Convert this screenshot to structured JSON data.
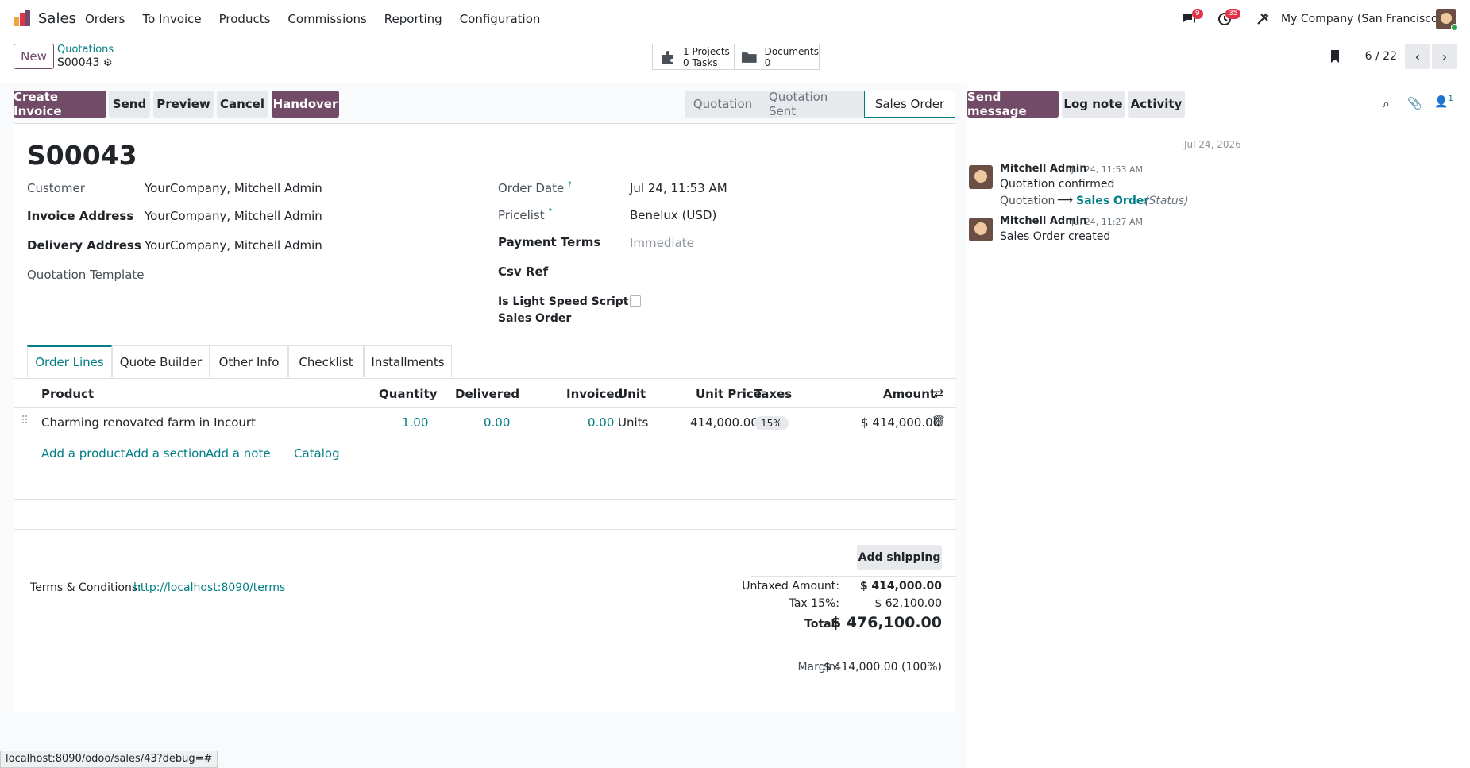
{
  "navbar": {
    "app_name": "Sales",
    "menu": [
      "Orders",
      "To Invoice",
      "Products",
      "Commissions",
      "Reporting",
      "Configuration"
    ],
    "messages_count": "9",
    "activities_count": "35",
    "company": "My Company (San Francisco)"
  },
  "control": {
    "new_label": "New",
    "breadcrumb_parent": "Quotations",
    "breadcrumb_current": "S00043",
    "smart_projects_count": "1",
    "smart_projects_label": "Projects",
    "smart_tasks_count": "0",
    "smart_tasks_label": "Tasks",
    "smart_documents_label": "Documents",
    "smart_documents_count": "0",
    "pager": "6 / 22"
  },
  "actions": [
    "Create Invoice",
    "Send",
    "Preview",
    "Cancel",
    "Handover"
  ],
  "statusbar": {
    "stages": [
      "Quotation",
      "Quotation Sent",
      "Sales Order"
    ],
    "active": "Sales Order"
  },
  "order": {
    "name": "S00043",
    "customer_label": "Customer",
    "customer": "YourCompany, Mitchell Admin",
    "invoice_address_label": "Invoice Address",
    "invoice_address": "YourCompany, Mitchell Admin",
    "delivery_address_label": "Delivery Address",
    "delivery_address": "YourCompany, Mitchell Admin",
    "quotation_template_label": "Quotation Template",
    "order_date_label": "Order Date",
    "order_date": "Jul 24, 11:53 AM",
    "pricelist_label": "Pricelist",
    "pricelist": "Benelux (USD)",
    "payment_terms_label": "Payment Terms",
    "payment_terms_placeholder": "Immediate",
    "csv_ref_label": "Csv Ref",
    "light_speed_label_1": "Is Light Speed Script",
    "light_speed_label_2": "Sales Order",
    "help_mark": "?"
  },
  "tabs": [
    "Order Lines",
    "Quote Builder",
    "Other Info",
    "Checklist",
    "Installments"
  ],
  "table": {
    "headers": {
      "product": "Product",
      "quantity": "Quantity",
      "delivered": "Delivered",
      "invoiced": "Invoiced",
      "unit": "Unit",
      "unit_price": "Unit Price",
      "taxes": "Taxes",
      "amount": "Amount"
    },
    "rows": [
      {
        "product": "Charming renovated farm in Incourt",
        "quantity": "1.00",
        "delivered": "0.00",
        "invoiced": "0.00",
        "unit": "Units",
        "unit_price": "414,000.00",
        "taxes": "15%",
        "amount": "$ 414,000.00"
      }
    ],
    "add_product": "Add a product",
    "add_section": "Add a section",
    "add_note": "Add a note",
    "catalog": "Catalog"
  },
  "footer": {
    "add_shipping": "Add shipping",
    "terms_label": "Terms & Conditions:",
    "terms_link": "http://localhost:8090/terms",
    "untaxed_label": "Untaxed Amount:",
    "untaxed": "$ 414,000.00",
    "tax_label": "Tax 15%:",
    "tax": "$ 62,100.00",
    "total_label": "Total:",
    "total": "$ 476,100.00",
    "margin_label": "Margin:",
    "margin": "$ 414,000.00 (100%)"
  },
  "chatter": {
    "send_message": "Send message",
    "log_note": "Log note",
    "activity": "Activity",
    "followers_count": "1",
    "date_separator": "Jul 24, 2026",
    "messages": [
      {
        "author": "Mitchell Admin",
        "time": "Jul 24, 11:53 AM",
        "body": "Quotation confirmed",
        "tracking_old": "Quotation",
        "tracking_new": "Sales Order",
        "tracking_field": "(Status)"
      },
      {
        "author": "Mitchell Admin",
        "time": "Jul 24, 11:27 AM",
        "body": "Sales Order created"
      }
    ]
  },
  "status_url": "localhost:8090/odoo/sales/43?debug=#"
}
